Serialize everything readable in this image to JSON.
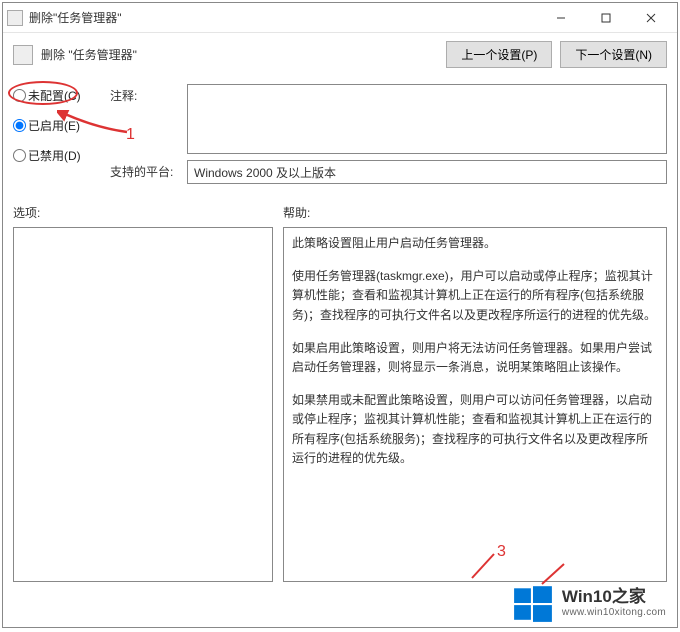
{
  "window": {
    "title": "删除\"任务管理器\""
  },
  "header": {
    "title": "删除 \"任务管理器\"",
    "prev_button": "上一个设置(P)",
    "next_button": "下一个设置(N)"
  },
  "radios": {
    "not_configured": "未配置(C)",
    "enabled": "已启用(E)",
    "disabled": "已禁用(D)"
  },
  "labels": {
    "comment": "注释:",
    "supported_on": "支持的平台:",
    "options": "选项:",
    "help": "帮助:"
  },
  "supported_on_text": "Windows 2000 及以上版本",
  "help_paragraphs": {
    "p0": "此策略设置阻止用户启动任务管理器。",
    "p1": "使用任务管理器(taskmgr.exe)，用户可以启动或停止程序；监视其计算机性能；查看和监视其计算机上正在运行的所有程序(包括系统服务)；查找程序的可执行文件名以及更改程序所运行的进程的优先级。",
    "p2": "如果启用此策略设置，则用户将无法访问任务管理器。如果用户尝试启动任务管理器，则将显示一条消息，说明某策略阻止该操作。",
    "p3": "如果禁用或未配置此策略设置，则用户可以访问任务管理器，以启动或停止程序；监视其计算机性能；查看和监视其计算机上正在运行的所有程序(包括系统服务)；查找程序的可执行文件名以及更改程序所运行的进程的优先级。"
  },
  "annotations": {
    "num1": "1",
    "num3": "3"
  },
  "watermark": {
    "line1": "Win10之家",
    "line2": "www.win10xitong.com"
  }
}
